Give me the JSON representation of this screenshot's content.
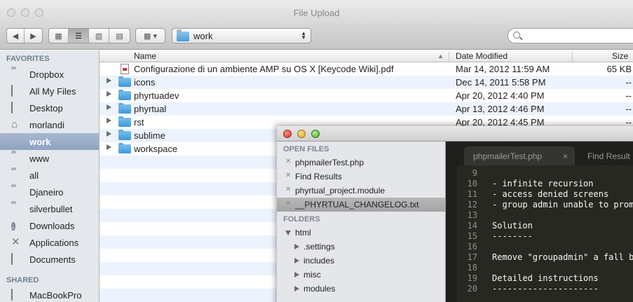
{
  "finder": {
    "title": "File Upload",
    "path_label": "work",
    "columns": {
      "name": "Name",
      "date": "Date Modified",
      "size": "Size"
    },
    "sidebar": {
      "favorites_header": "FAVORITES",
      "shared_header": "SHARED",
      "items": [
        {
          "label": "Dropbox",
          "icon": "folder-icon"
        },
        {
          "label": "All My Files",
          "icon": "all-files-icon"
        },
        {
          "label": "Desktop",
          "icon": "desktop-icon"
        },
        {
          "label": "morlandi",
          "icon": "home-icon"
        },
        {
          "label": "work",
          "icon": "folder-icon",
          "selected": true
        },
        {
          "label": "www",
          "icon": "folder-icon"
        },
        {
          "label": "all",
          "icon": "folder-icon"
        },
        {
          "label": "Djaneiro",
          "icon": "folder-icon"
        },
        {
          "label": "silverbullet",
          "icon": "folder-icon"
        },
        {
          "label": "Downloads",
          "icon": "downloads-icon"
        },
        {
          "label": "Applications",
          "icon": "applications-icon"
        },
        {
          "label": "Documents",
          "icon": "documents-icon"
        }
      ],
      "shared_items": [
        {
          "label": "MacBookPro",
          "icon": "computer-icon"
        }
      ]
    },
    "files": [
      {
        "name": "Configurazione di un ambiente AMP su OS X [Keycode Wiki].pdf",
        "date": "Mar 14, 2012 11:59 AM",
        "size": "65 KB",
        "kind": "pdf"
      },
      {
        "name": "icons",
        "date": "Dec 14, 2011 5:58 PM",
        "size": "--",
        "kind": "folder"
      },
      {
        "name": "phyrtuadev",
        "date": "Apr 20, 2012 4:40 PM",
        "size": "--",
        "kind": "folder"
      },
      {
        "name": "phyrtual",
        "date": "Apr 13, 2012 4:46 PM",
        "size": "--",
        "kind": "folder"
      },
      {
        "name": "rst",
        "date": "Apr 20, 2012 4:45 PM",
        "size": "--",
        "kind": "folder"
      },
      {
        "name": "sublime",
        "date": "",
        "size": "",
        "kind": "folder"
      },
      {
        "name": "workspace",
        "date": "",
        "size": "",
        "kind": "folder"
      }
    ]
  },
  "sublime": {
    "open_files_header": "OPEN FILES",
    "folders_header": "FOLDERS",
    "open_files": [
      {
        "label": "phpmailerTest.php"
      },
      {
        "label": "Find Results"
      },
      {
        "label": "phyrtual_project.module"
      },
      {
        "label": "__PHYRTUAL_CHANGELOG.txt",
        "selected": true
      }
    ],
    "folders": [
      {
        "label": "html",
        "expanded": true
      },
      {
        "label": ".settings"
      },
      {
        "label": "includes"
      },
      {
        "label": "misc"
      },
      {
        "label": "modules"
      }
    ],
    "tabs": [
      {
        "label": "phpmailerTest.php",
        "close": "×"
      },
      {
        "label": "Find Result"
      }
    ],
    "lines": [
      {
        "n": "9",
        "text": ""
      },
      {
        "n": "10",
        "text": "- infinite recursion"
      },
      {
        "n": "11",
        "text": "- access denied screens"
      },
      {
        "n": "12",
        "text": "- group admin unable to promo"
      },
      {
        "n": "13",
        "text": ""
      },
      {
        "n": "14",
        "text": "Solution"
      },
      {
        "n": "15",
        "text": "--------"
      },
      {
        "n": "16",
        "text": ""
      },
      {
        "n": "17",
        "text": "Remove \"groupadmin\" a fall ba"
      },
      {
        "n": "18",
        "text": ""
      },
      {
        "n": "19",
        "text": "Detailed instructions"
      },
      {
        "n": "20",
        "text": "---------------------"
      }
    ]
  }
}
